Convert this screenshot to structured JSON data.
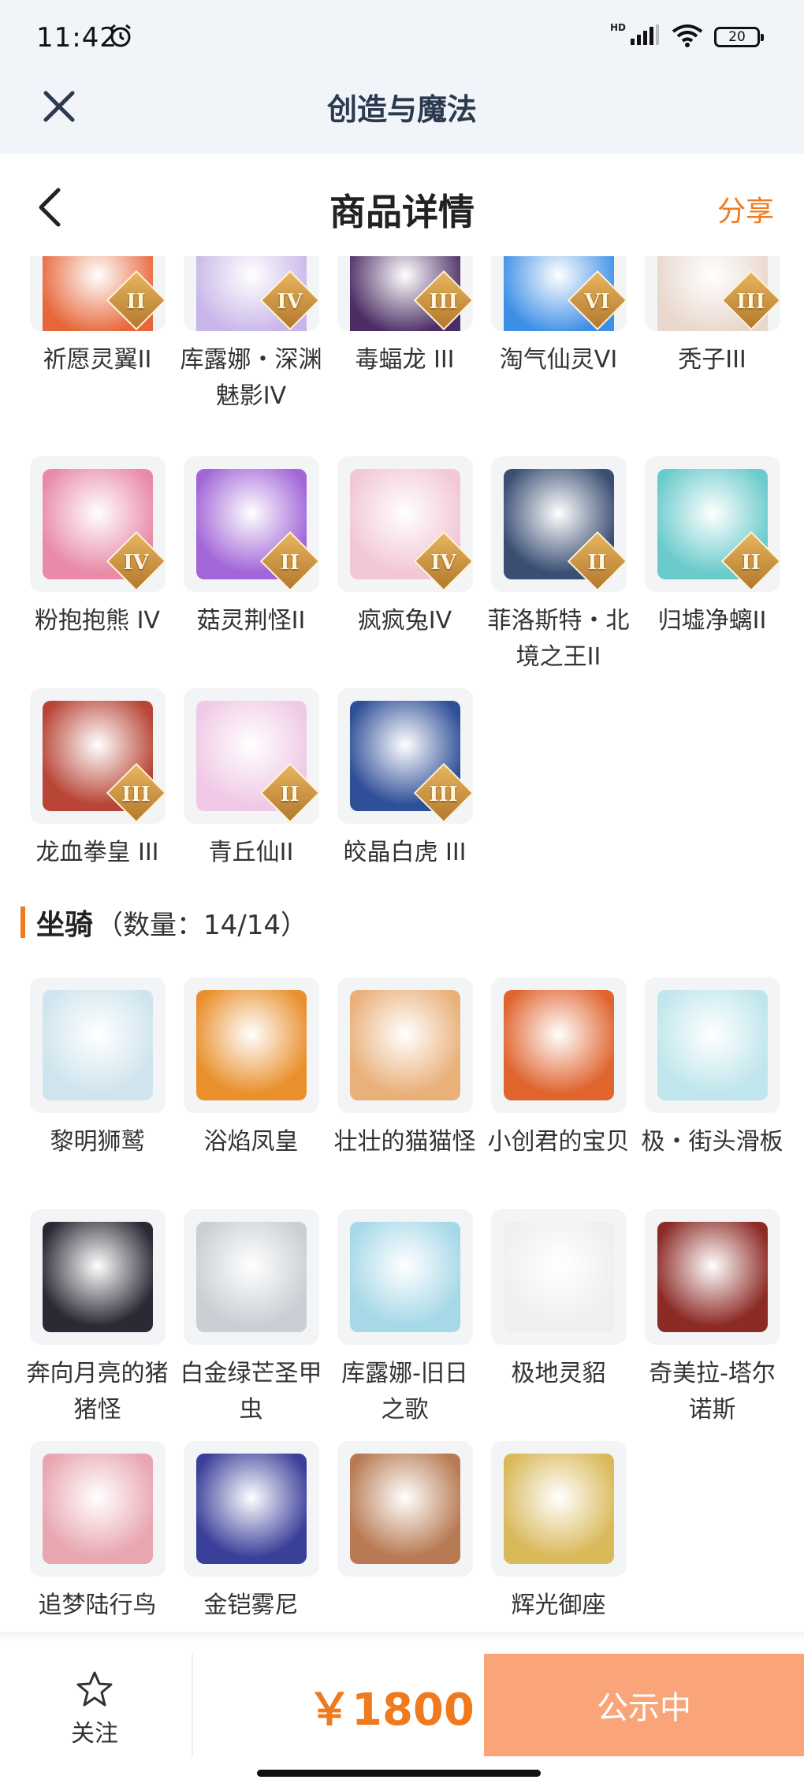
{
  "status_bar": {
    "time": "11:42",
    "network": "HD",
    "battery": "20"
  },
  "app_bar": {
    "title": "创造与魔法"
  },
  "header": {
    "title": "商品详情",
    "share": "分享"
  },
  "pets_top": [
    {
      "name": "祈愿灵翼II",
      "tier": "II",
      "color": "#e7673a"
    },
    {
      "name": "库露娜・深渊魅影IV",
      "tier": "IV",
      "color": "#c8b6e8"
    },
    {
      "name": "毒蝠龙 III",
      "tier": "III",
      "color": "#4b2c63"
    },
    {
      "name": "淘气仙灵VI",
      "tier": "VI",
      "color": "#3c8ee6"
    },
    {
      "name": "秃子III",
      "tier": "III",
      "color": "#e8d7cc"
    },
    {
      "name": "粉抱抱熊 IV",
      "tier": "IV",
      "color": "#e98aa8"
    },
    {
      "name": "菇灵荆怪II",
      "tier": "II",
      "color": "#a266d8"
    },
    {
      "name": "疯疯兔IV",
      "tier": "IV",
      "color": "#f2c7d6"
    },
    {
      "name": "菲洛斯特・北境之王II",
      "tier": "II",
      "color": "#3a4e73"
    },
    {
      "name": "归墟净螭II",
      "tier": "II",
      "color": "#6bcbcc"
    },
    {
      "name": "龙血拳皇 III",
      "tier": "III",
      "color": "#b84536"
    },
    {
      "name": "青丘仙II",
      "tier": "II",
      "color": "#f0c9e6"
    },
    {
      "name": "皎晶白虎 III",
      "tier": "III",
      "color": "#2f4f98"
    }
  ],
  "mounts_section": {
    "label": "坐骑",
    "count": "（数量：14/14）"
  },
  "mounts": [
    {
      "name": "黎明狮鹫",
      "color": "#cfe4ee"
    },
    {
      "name": "浴焰凤皇",
      "color": "#e9902c"
    },
    {
      "name": "壮壮的猫猫怪",
      "color": "#e9b07a"
    },
    {
      "name": "小创君的宝贝",
      "color": "#e0642e"
    },
    {
      "name": "极・街头滑板",
      "color": "#bfe6ec"
    },
    {
      "name": "奔向月亮的猪猪怪",
      "color": "#2a2a35"
    },
    {
      "name": "白金绿芒圣甲虫",
      "color": "#c9cfd4"
    },
    {
      "name": "库露娜-旧日之歌",
      "color": "#a6d8e8"
    },
    {
      "name": "极地灵貂",
      "color": "#efefef"
    },
    {
      "name": "奇美拉-塔尔诺斯",
      "color": "#8c2a25"
    },
    {
      "name": "追梦陆行鸟",
      "color": "#e8a6b0"
    },
    {
      "name": "金铠雾尼",
      "color": "#3a3f9a"
    },
    {
      "name": "",
      "color": "#b87a52"
    },
    {
      "name": "辉光御座",
      "color": "#d9b95a"
    }
  ],
  "bottom": {
    "follow": "关注",
    "price": "￥1800",
    "status": "公示中"
  },
  "colors": {
    "accent": "#f07a1e",
    "button": "#f9a579",
    "app_bg": "#f1f4f8"
  }
}
